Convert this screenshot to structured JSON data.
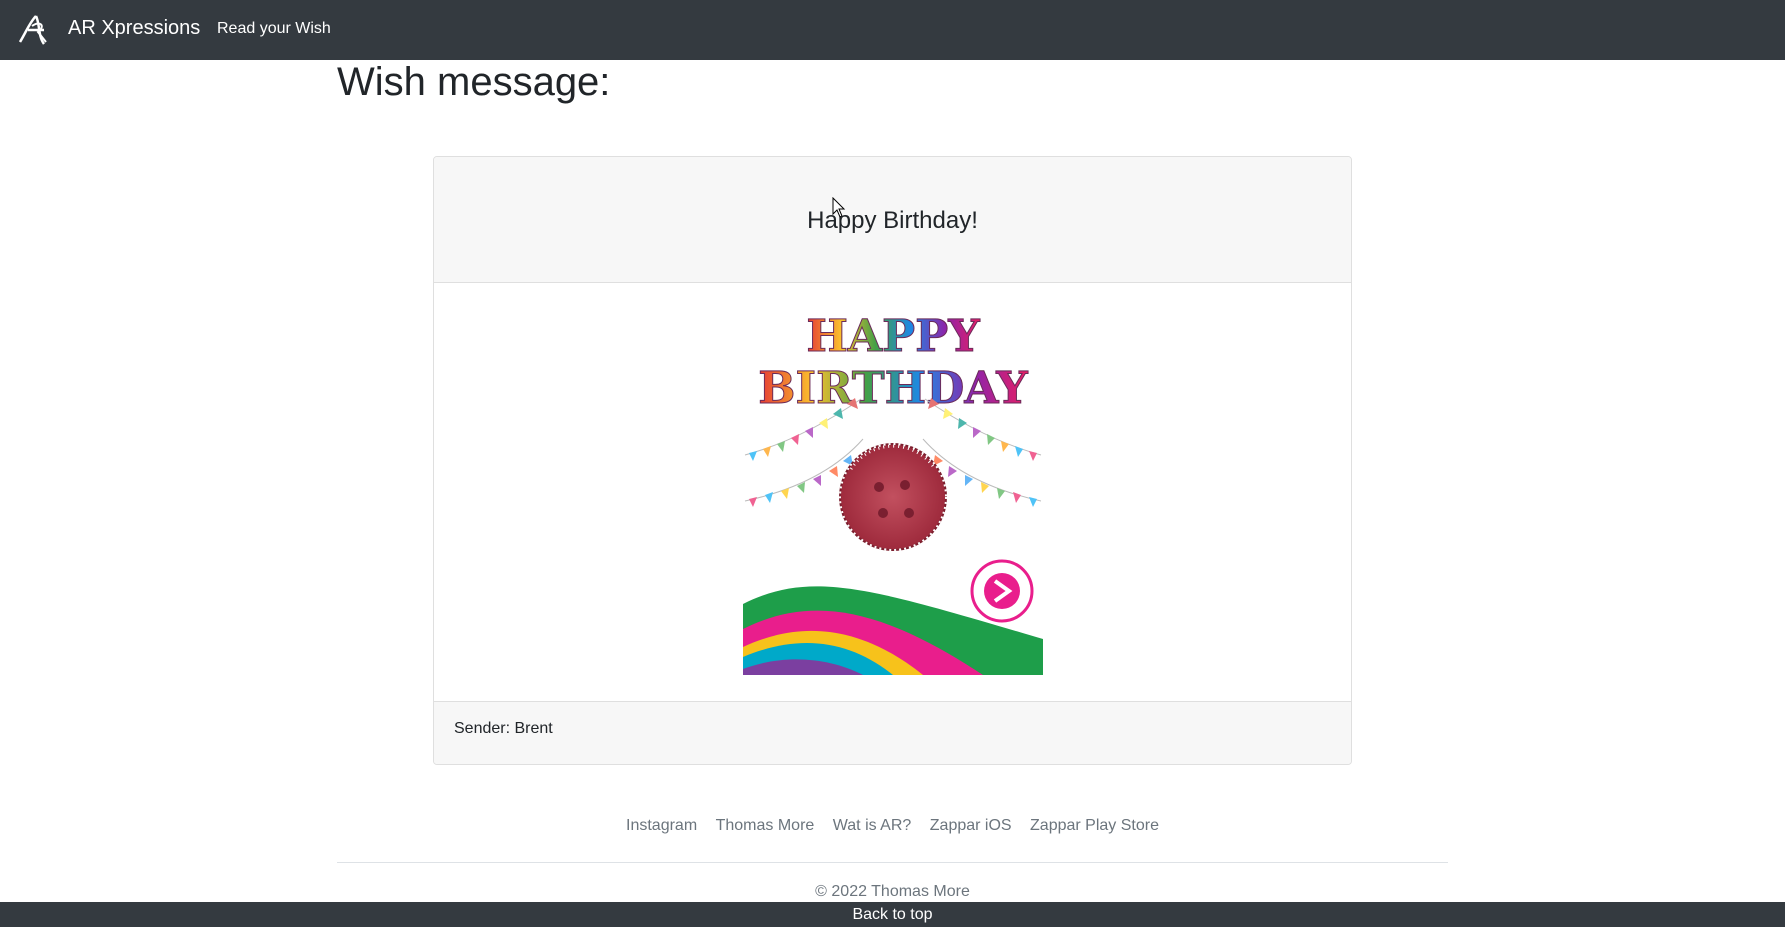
{
  "navbar": {
    "brand": "AR Xpressions",
    "nav_link": "Read your Wish"
  },
  "page": {
    "title": "Wish message:"
  },
  "card": {
    "title": "Happy Birthday!",
    "sender": "Sender: Brent",
    "image_text": [
      "HAPPY",
      "BIRTHDAY"
    ]
  },
  "footer": {
    "links": [
      "Instagram",
      "Thomas More",
      "Wat is AR?",
      "Zappar iOS",
      "Zappar Play Store"
    ],
    "copyright": "© 2022 Thomas More",
    "back_to_top": "Back to top"
  },
  "colors": {
    "navbar": "#343a40",
    "card_header": "#f7f7f7",
    "link_muted": "#6c757d"
  }
}
